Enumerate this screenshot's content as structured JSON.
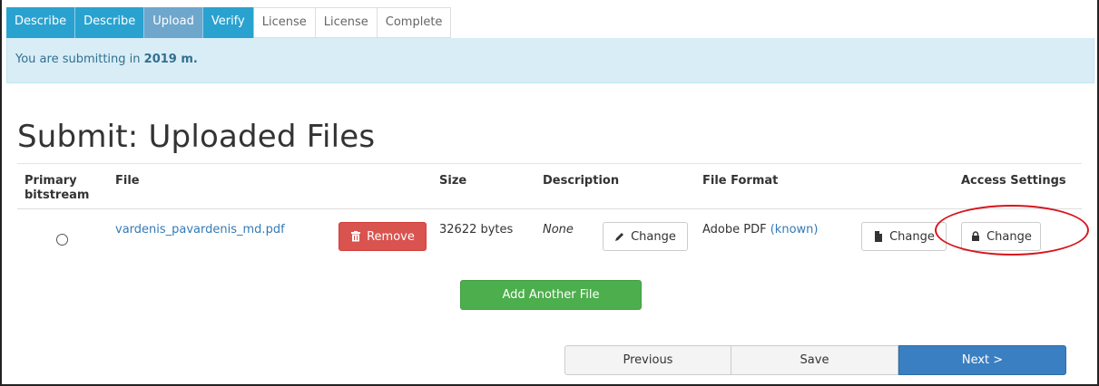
{
  "tabs": [
    {
      "label": "Describe",
      "state": "done"
    },
    {
      "label": "Describe",
      "state": "done"
    },
    {
      "label": "Upload",
      "state": "current"
    },
    {
      "label": "Verify",
      "state": "done"
    },
    {
      "label": "License",
      "state": "todo"
    },
    {
      "label": "License",
      "state": "todo"
    },
    {
      "label": "Complete",
      "state": "todo"
    }
  ],
  "alert": {
    "prefix": "You are submitting in ",
    "collection": "2019 m."
  },
  "page_title": "Submit: Uploaded Files",
  "table": {
    "headers": {
      "primary": "Primary bitstream",
      "file": "File",
      "size": "Size",
      "description": "Description",
      "format": "File Format",
      "access": "Access Settings"
    },
    "row": {
      "file_name": "vardenis_pavardenis_md.pdf",
      "remove_label": "Remove",
      "size": "32622 bytes",
      "description": "None",
      "desc_change_label": "Change",
      "format": "Adobe PDF",
      "format_known": "(known)",
      "format_change_label": "Change",
      "access_change_label": "Change"
    }
  },
  "add_file_label": "Add Another File",
  "pager": {
    "previous": "Previous",
    "save": "Save",
    "next": "Next >"
  },
  "colors": {
    "highlight": "#d8141b",
    "primary": "#3a7fc1",
    "danger": "#d9534f",
    "success": "#4cae4c"
  }
}
